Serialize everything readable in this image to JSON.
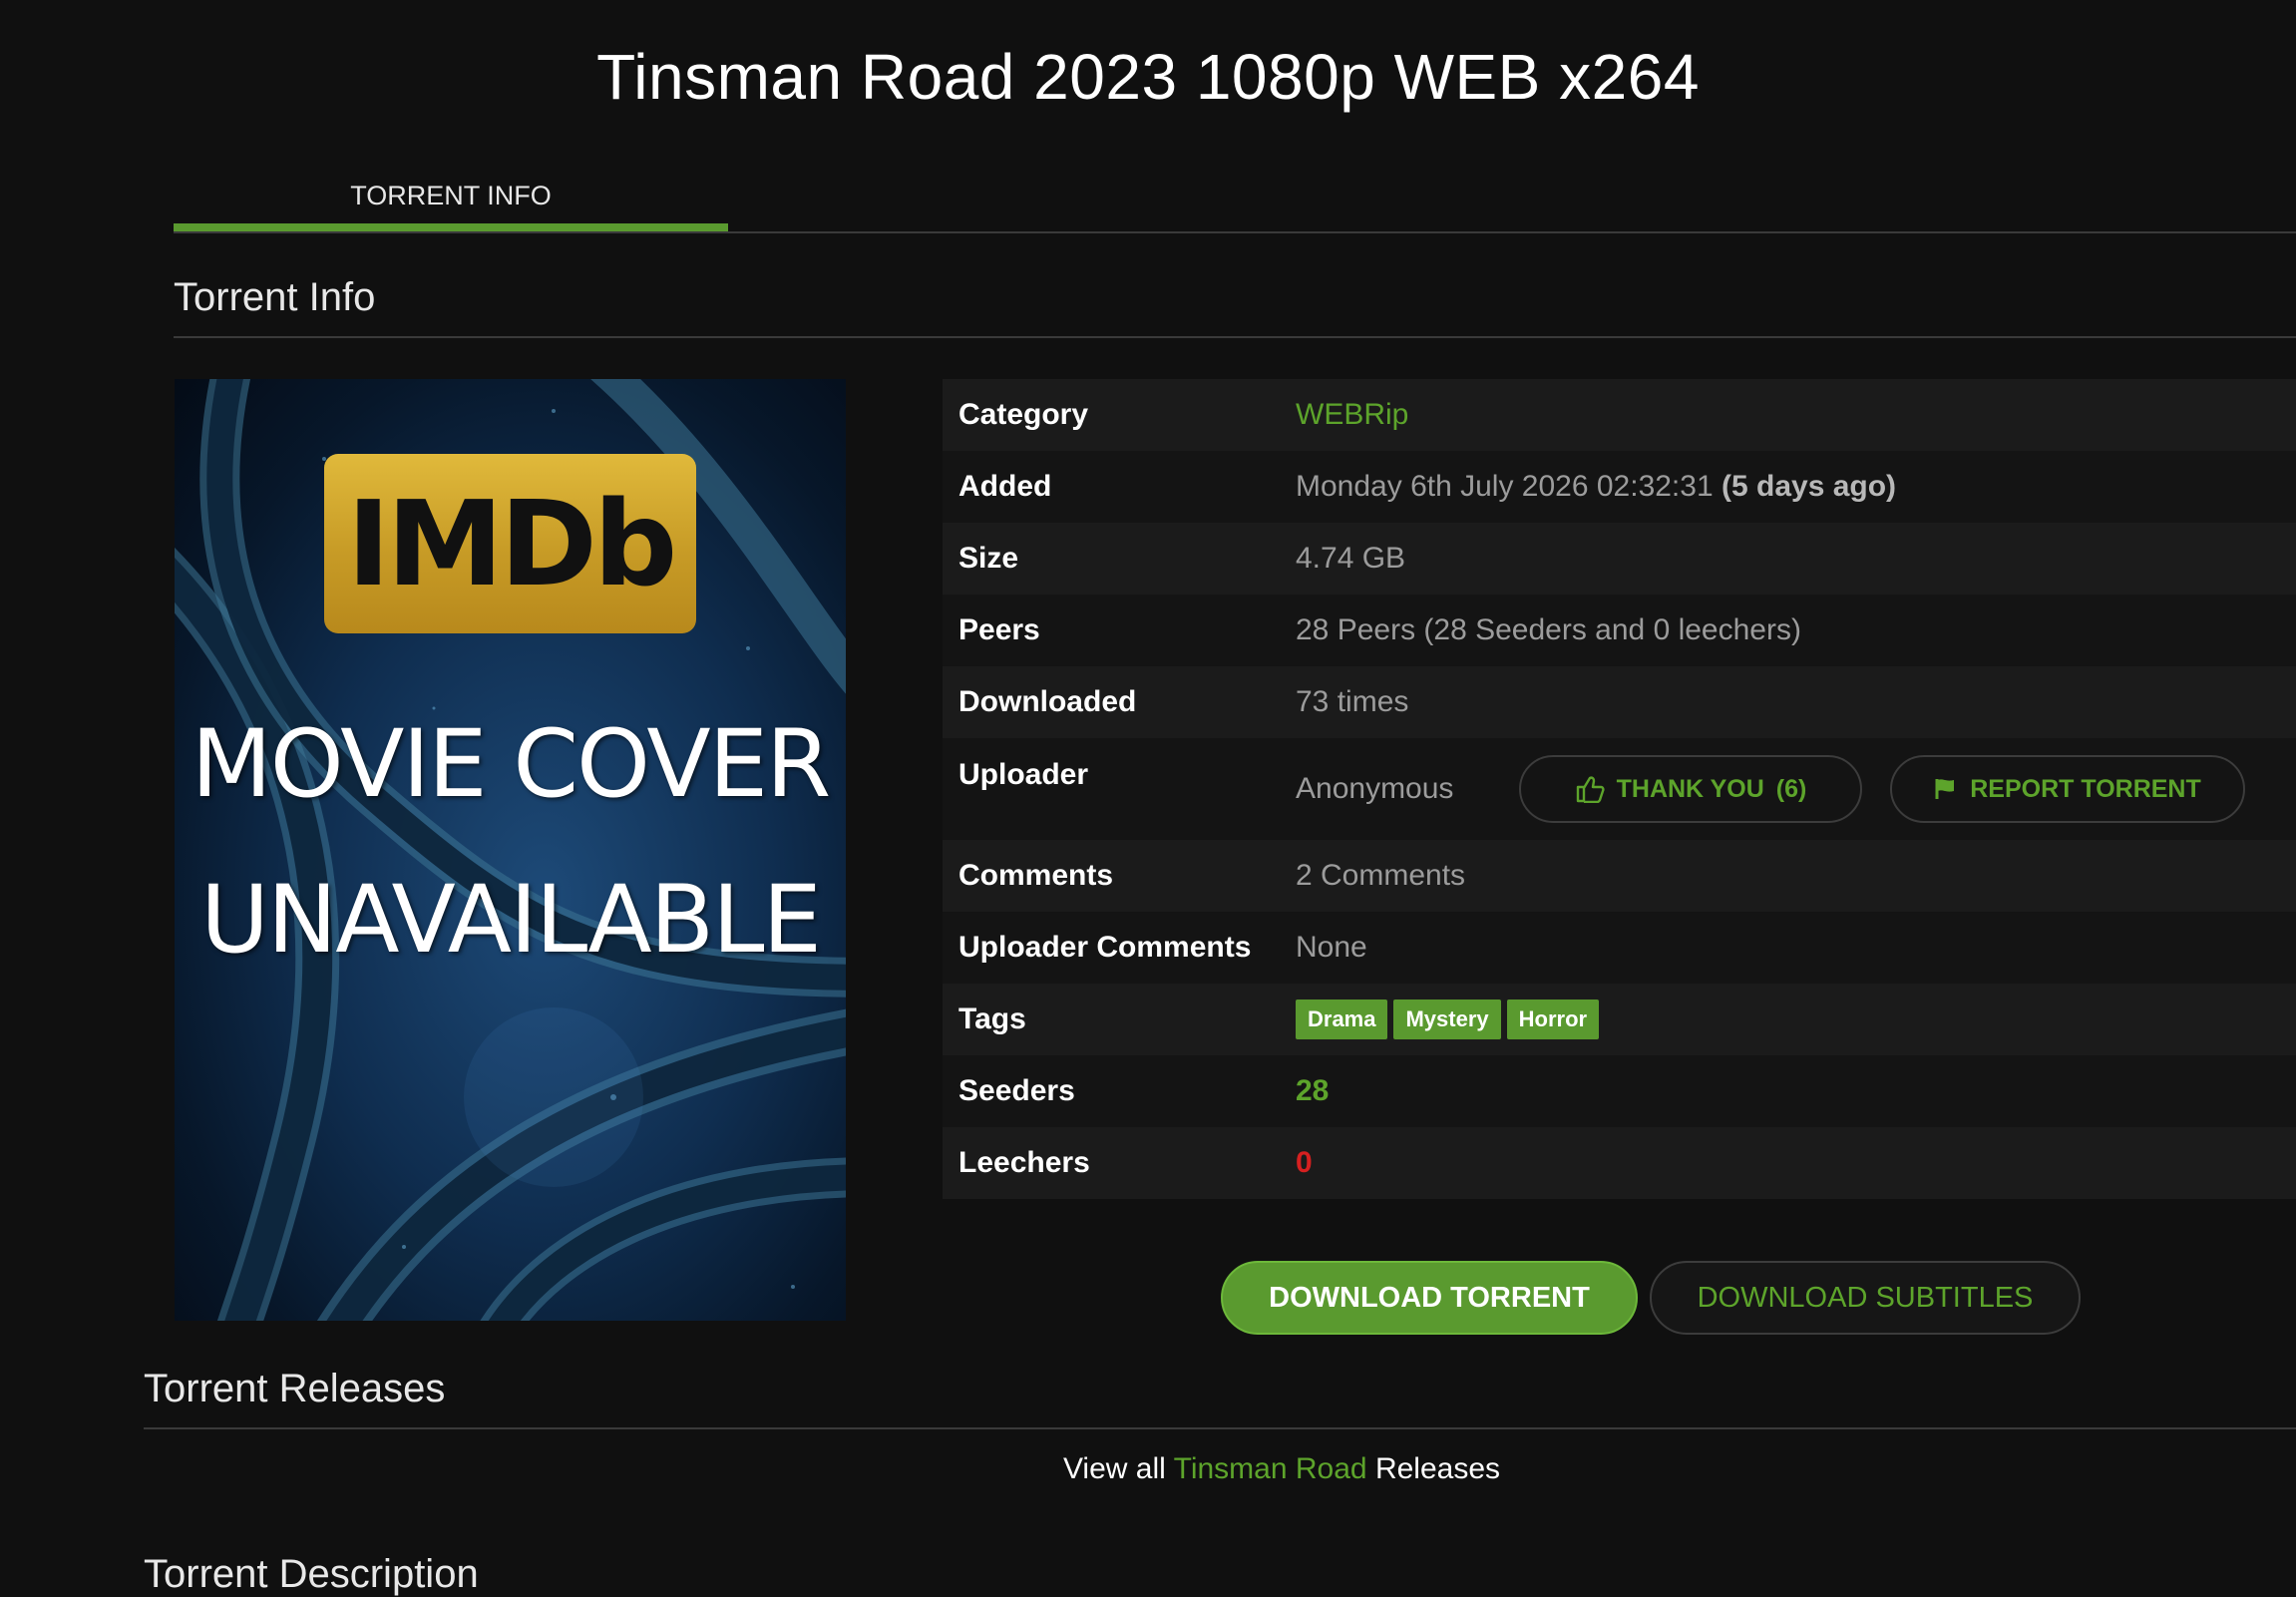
{
  "page": {
    "title": "Tinsman Road 2023 1080p WEB x264"
  },
  "tabs": [
    {
      "label": "TORRENT INFO",
      "active": true
    }
  ],
  "sections": {
    "torrent_info": "Torrent Info",
    "torrent_releases": "Torrent Releases",
    "torrent_description": "Torrent Description"
  },
  "cover": {
    "badge_text": "IMDb",
    "line1": "MOVIE COVER",
    "line2": "UNAVAILABLE"
  },
  "info": {
    "category": {
      "label": "Category",
      "value": "WEBRip"
    },
    "added": {
      "label": "Added",
      "value": "Monday 6th July 2026 02:32:31",
      "relative": "(5 days ago)"
    },
    "size": {
      "label": "Size",
      "value": "4.74 GB"
    },
    "peers": {
      "label": "Peers",
      "value": "28 Peers (28 Seeders and 0 leechers)"
    },
    "downloaded": {
      "label": "Downloaded",
      "value": "73 times"
    },
    "uploader": {
      "label": "Uploader",
      "value": "Anonymous"
    },
    "comments": {
      "label": "Comments",
      "value": "2 Comments"
    },
    "uploader_comments": {
      "label": "Uploader Comments",
      "value": "None"
    },
    "tags": {
      "label": "Tags",
      "items": [
        "Drama",
        "Mystery",
        "Horror"
      ]
    },
    "seeders": {
      "label": "Seeders",
      "value": "28"
    },
    "leechers": {
      "label": "Leechers",
      "value": "0"
    }
  },
  "buttons": {
    "thank_you": "THANK YOU",
    "thank_count": "(6)",
    "report": "REPORT TORRENT",
    "download_torrent": "DOWNLOAD TORRENT",
    "download_subtitles": "DOWNLOAD SUBTITLES"
  },
  "releases": {
    "prefix": "View all",
    "link": "Tinsman Road",
    "suffix": "Releases"
  },
  "colors": {
    "accent": "#5a9a2f",
    "link": "#5da42b",
    "danger": "#d62020",
    "background": "#101010"
  }
}
